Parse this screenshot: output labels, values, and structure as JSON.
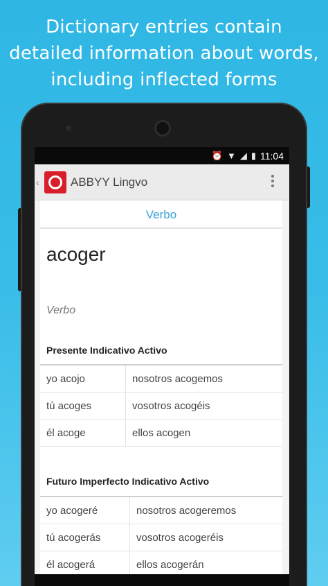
{
  "headline": [
    "Dictionary entries contain",
    "detailed information about words,",
    "including inflected forms"
  ],
  "status_bar": {
    "time": "11:04"
  },
  "app_bar": {
    "title": "ABBYY Lingvo"
  },
  "entry": {
    "tab_label": "Verbo",
    "word": "acoger",
    "part_of_speech": "Verbo",
    "sections": [
      {
        "title": "Presente Indicativo Activo",
        "rows": [
          [
            "yo acojo",
            "nosotros acogemos"
          ],
          [
            "tú acoges",
            "vosotros acogéis"
          ],
          [
            "él acoge",
            "ellos acogen"
          ]
        ]
      },
      {
        "title": "Futuro Imperfecto Indicativo Activo",
        "rows": [
          [
            "yo acogeré",
            "nosotros acogeremos"
          ],
          [
            "tú acogerás",
            "vosotros acogeréis"
          ],
          [
            "él acogerá",
            "ellos acogerán"
          ]
        ]
      }
    ]
  },
  "colors": {
    "background": "#39bde8",
    "accent": "#36a6d8",
    "logo_red": "#d81e2a"
  }
}
